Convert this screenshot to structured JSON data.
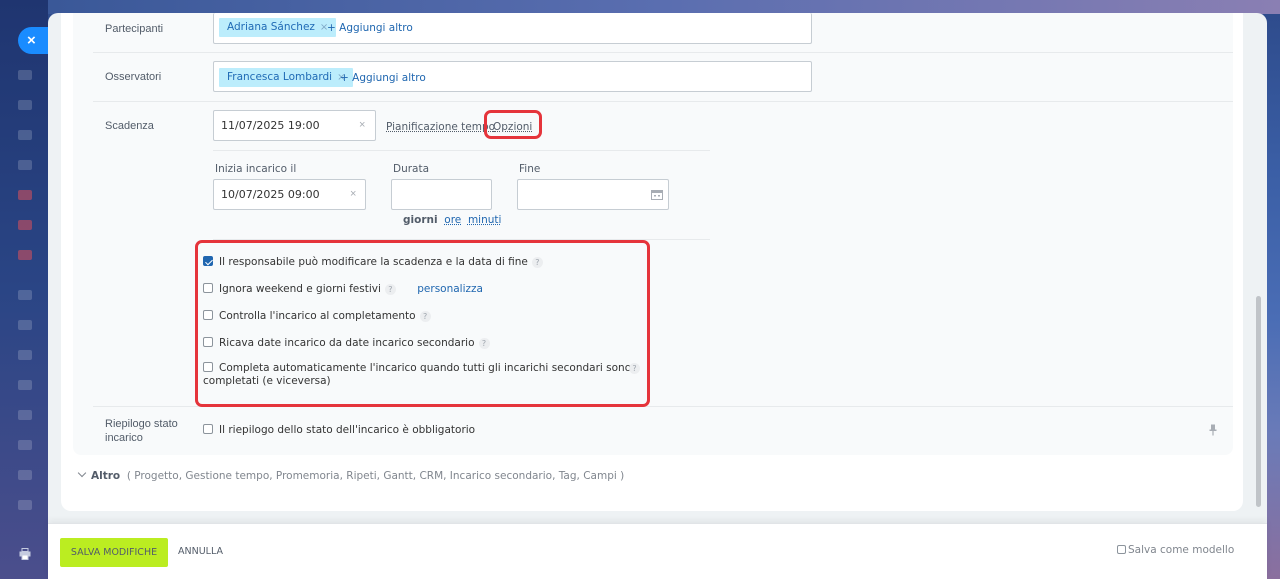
{
  "sidebar": {
    "close_symbol": "×"
  },
  "participants": {
    "label": "Partecipanti",
    "tag": "Adriana Sánchez",
    "tag_remove": "×",
    "add_more": "+ Aggiungi altro"
  },
  "observers": {
    "label": "Osservatori",
    "tag": "Francesca Lombardi",
    "tag_remove": "×",
    "add_more": "+ Aggiungi altro"
  },
  "deadline": {
    "label": "Scadenza",
    "value": "11/07/2025 19:00",
    "clear": "×",
    "planning_label": "Pianificazione tempo",
    "options_link": "Opzioni"
  },
  "schedule": {
    "start_label": "Inizia incarico il",
    "start_value": "10/07/2025 09:00",
    "start_clear": "×",
    "duration_label": "Durata",
    "duration_value": "",
    "units": {
      "days": "giorni",
      "hours": "ore",
      "minutes": "minuti"
    },
    "end_label": "Fine",
    "end_value": ""
  },
  "options": [
    {
      "label": "Il responsabile può modificare la scadenza e la data di fine",
      "checked": true
    },
    {
      "label": "Ignora weekend e giorni festivi",
      "checked": false,
      "link": "personalizza"
    },
    {
      "label": "Controlla l'incarico al completamento",
      "checked": false
    },
    {
      "label": "Ricava date incarico da date incarico secondario",
      "checked": false
    },
    {
      "label_line1": "Completa automaticamente l'incarico quando tutti gli incarichi secondari sono",
      "label_line2": "completati (e viceversa)",
      "checked": false
    }
  ],
  "help_symbol": "?",
  "status_summary": {
    "label_line1": "Riepilogo stato",
    "label_line2": "incarico",
    "checkbox_label": "Il riepilogo dello stato dell'incarico è obbligatorio",
    "checked": false
  },
  "more": {
    "label": "Altro",
    "items": "( Progetto,  Gestione tempo,  Promemoria,  Ripeti,  Gantt,  CRM,  Incarico secondario,  Tag,  Campi )"
  },
  "footer": {
    "save": "SALVA MODIFICHE",
    "cancel": "ANNULLA",
    "save_template": "Salva come modello"
  },
  "colors": {
    "accent_blue": "#2067b0",
    "highlight_red": "#e5343b",
    "save_green": "#bbed21",
    "tag_bg": "#bcedfc"
  }
}
